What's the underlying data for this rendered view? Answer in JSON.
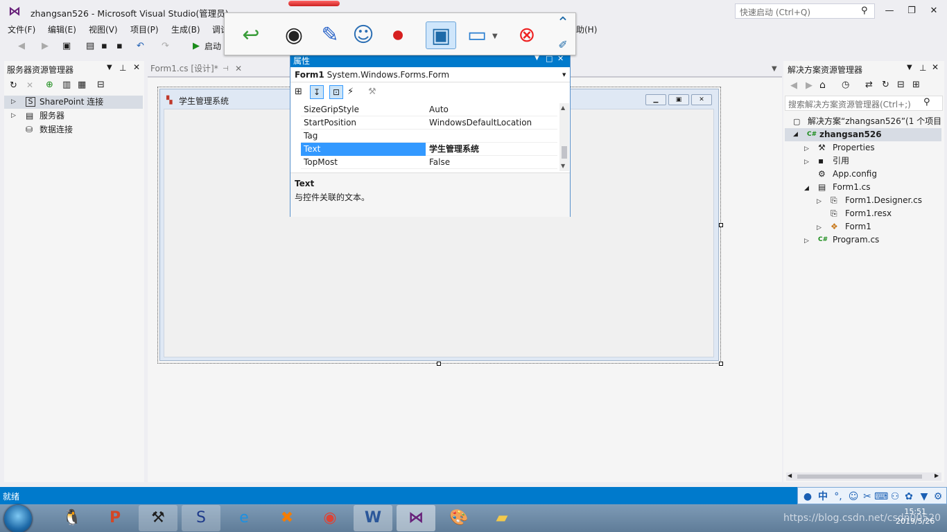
{
  "titlebar": {
    "title": "zhangsan526 - Microsoft Visual Studio(管理员)",
    "quick_launch_placeholder": "快速启动 (Ctrl+Q)"
  },
  "menu": {
    "items": [
      "文件(F)",
      "编辑(E)",
      "视图(V)",
      "项目(P)",
      "生成(B)",
      "调试",
      "帮助(H)"
    ]
  },
  "toolbar": {
    "start_label": "启动"
  },
  "server_explorer": {
    "title": "服务器资源管理器",
    "items": [
      "SharePoint 连接",
      "服务器",
      "数据连接"
    ]
  },
  "document_tab": {
    "label": "Form1.cs [设计]*"
  },
  "form": {
    "caption": "学生管理系统"
  },
  "properties": {
    "title": "属性",
    "object_name": "Form1",
    "object_type": "System.Windows.Forms.Form",
    "rows": [
      {
        "name": "SizeGripStyle",
        "value": "Auto"
      },
      {
        "name": "StartPosition",
        "value": "WindowsDefaultLocation"
      },
      {
        "name": "Tag",
        "value": ""
      },
      {
        "name": "Text",
        "value": "学生管理系统"
      },
      {
        "name": "TopMost",
        "value": "False"
      }
    ],
    "selected_row": "Text",
    "desc_title": "Text",
    "desc_text": "与控件关联的文本。"
  },
  "solution_explorer": {
    "title": "解决方案资源管理器",
    "search_placeholder": "搜索解决方案资源管理器(Ctrl+;)",
    "solution_label": "解决方案“zhangsan526”(1 个项目",
    "project": "zhangsan526",
    "items": [
      "Properties",
      "引用",
      "App.config",
      "Form1.cs",
      "Form1.Designer.cs",
      "Form1.resx",
      "Form1",
      "Program.cs"
    ]
  },
  "status": {
    "text": "就绪"
  },
  "ime": {
    "label": "中"
  },
  "clock": {
    "time": "15:51",
    "date": "2019/5/26"
  },
  "watermark": "https://blog.csdn.net/csdn00520",
  "colors": {
    "accent": "#007acc",
    "vs_purple": "#68217a"
  }
}
